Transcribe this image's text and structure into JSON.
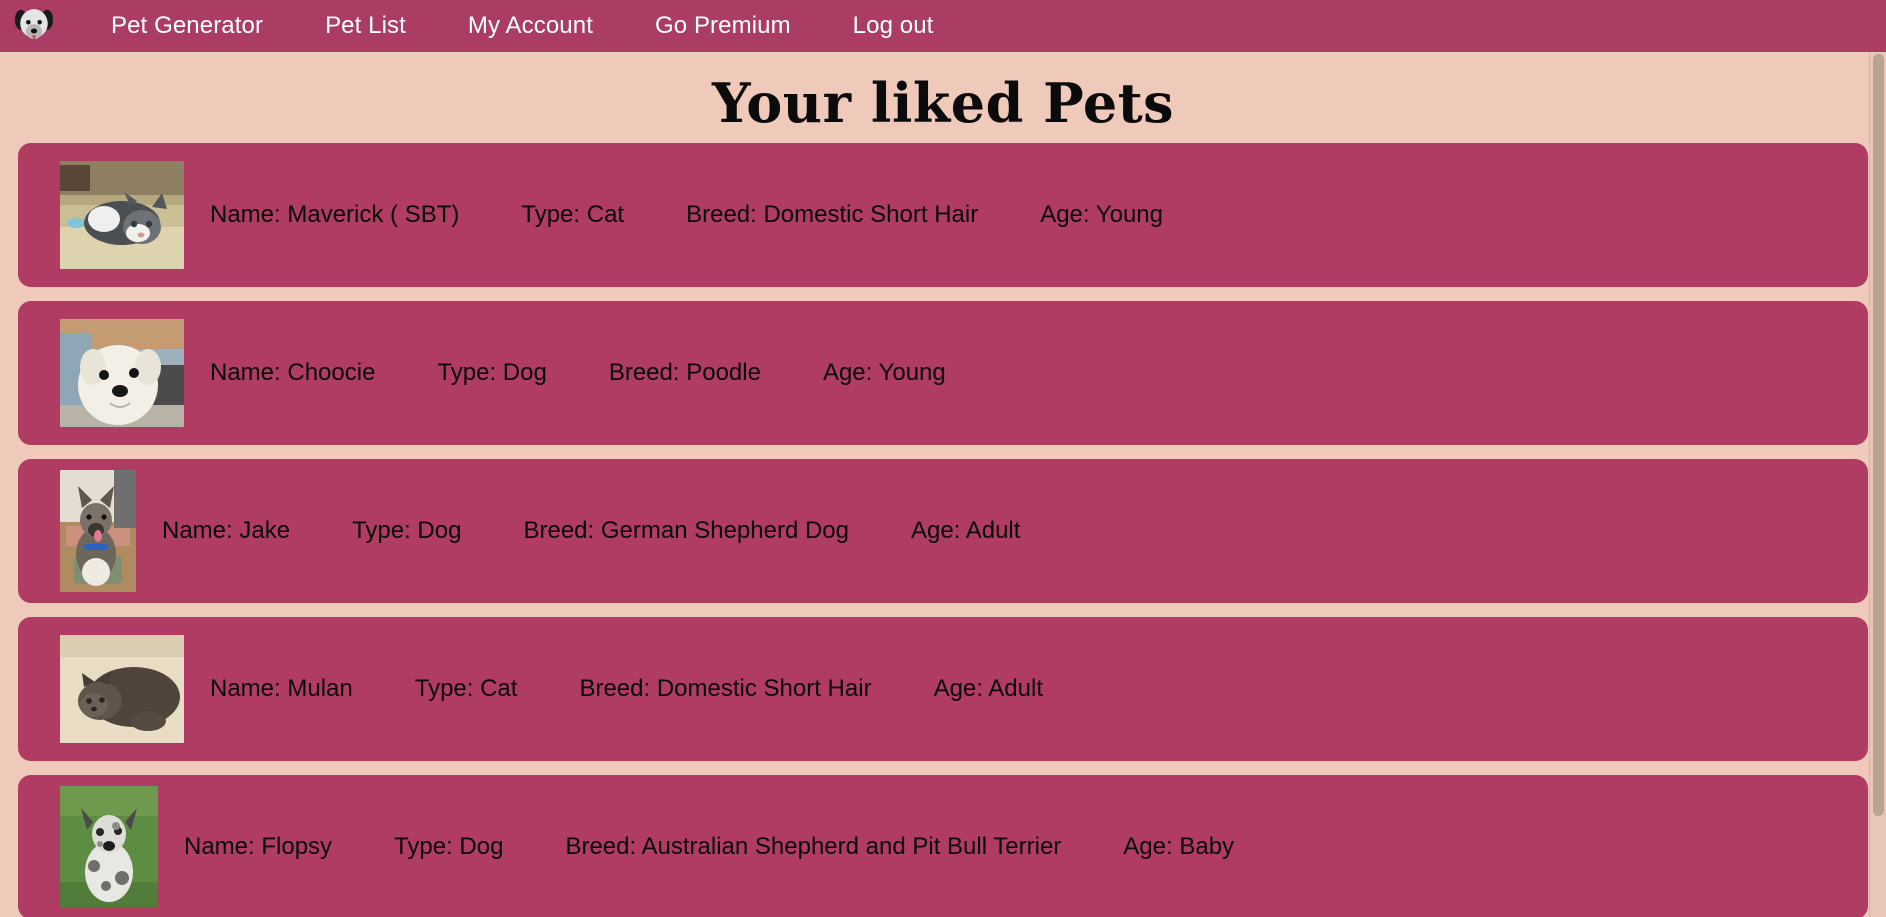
{
  "nav": {
    "logo_icon": "dog-face-logo",
    "links": [
      {
        "label": "Pet Generator"
      },
      {
        "label": "Pet List"
      },
      {
        "label": "My Account"
      },
      {
        "label": "Go Premium"
      },
      {
        "label": "Log out"
      }
    ]
  },
  "page": {
    "title": "Your liked Pets"
  },
  "colors": {
    "navbar": "#ab3c63",
    "card": "#b03c63",
    "background": "#efc9ba",
    "nav_text": "#ffffff",
    "card_text": "#0a0a0a",
    "scrollbar_thumb": "#b9a394"
  },
  "pets": [
    {
      "photo_alt": "grey-and-white-cat-in-cardboard-box",
      "name": "Name: Maverick ( SBT)",
      "type": "Type: Cat",
      "breed": "Breed: Domestic Short Hair",
      "age": "Age: Young"
    },
    {
      "photo_alt": "white-fluffy-poodle-puppy",
      "name": "Name: Choocie",
      "type": "Type: Dog",
      "breed": "Breed: Poodle",
      "age": "Age: Young"
    },
    {
      "photo_alt": "german-shepherd-sitting-indoors",
      "name": "Name: Jake",
      "type": "Type: Dog",
      "breed": "Breed: German Shepherd Dog",
      "age": "Age: Adult"
    },
    {
      "photo_alt": "dark-grey-cat-curled-on-blanket",
      "name": "Name: Mulan",
      "type": "Type: Cat",
      "breed": "Breed: Domestic Short Hair",
      "age": "Age: Adult"
    },
    {
      "photo_alt": "merle-spotted-puppy-on-grass",
      "name": "Name: Flopsy",
      "type": "Type: Dog",
      "breed": "Breed: Australian Shepherd and Pit Bull Terrier",
      "age": "Age: Baby"
    }
  ]
}
